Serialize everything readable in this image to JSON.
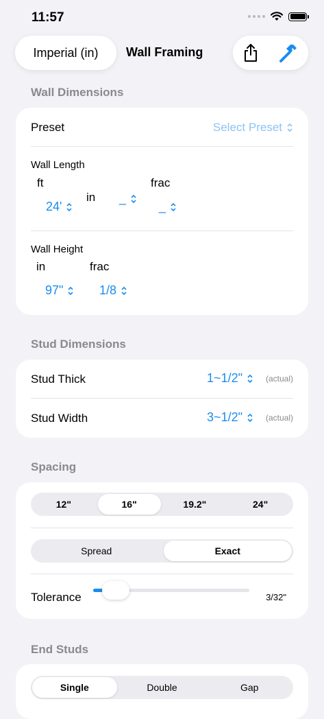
{
  "status": {
    "time": "11:57"
  },
  "nav": {
    "units": "Imperial (in)",
    "title": "Wall Framing",
    "share_icon": "share-icon",
    "hammer_icon": "hammer-icon"
  },
  "colors": {
    "accent": "#1a8cf0",
    "section_label": "#8a8a8e",
    "background": "#f2f2f7"
  },
  "wall_dimensions": {
    "section": "Wall Dimensions",
    "preset_label": "Preset",
    "preset_value": "Select Preset",
    "length": {
      "label": "Wall Length",
      "ft_label": "ft",
      "ft_value": "24'",
      "in_label": "in",
      "in_value": "_",
      "frac_label": "frac",
      "frac_value": "_"
    },
    "height": {
      "label": "Wall Height",
      "in_label": "in",
      "in_value": "97\"",
      "frac_label": "frac",
      "frac_value": "1/8"
    }
  },
  "stud_dimensions": {
    "section": "Stud Dimensions",
    "thick_label": "Stud Thick",
    "thick_value": "1~1/2\"",
    "thick_note": "(actual)",
    "width_label": "Stud Width",
    "width_value": "3~1/2\"",
    "width_note": "(actual)"
  },
  "spacing": {
    "section": "Spacing",
    "options": [
      "12\"",
      "16\"",
      "19.2\"",
      "24\""
    ],
    "selected": 1,
    "modes": [
      "Spread",
      "Exact"
    ],
    "mode_selected": 1,
    "tolerance_label": "Tolerance",
    "tolerance_value": "3/32\"",
    "tolerance_level": 0.1
  },
  "end_studs": {
    "section": "End Studs",
    "options": [
      "Single",
      "Double",
      "Gap"
    ],
    "selected": 0
  }
}
